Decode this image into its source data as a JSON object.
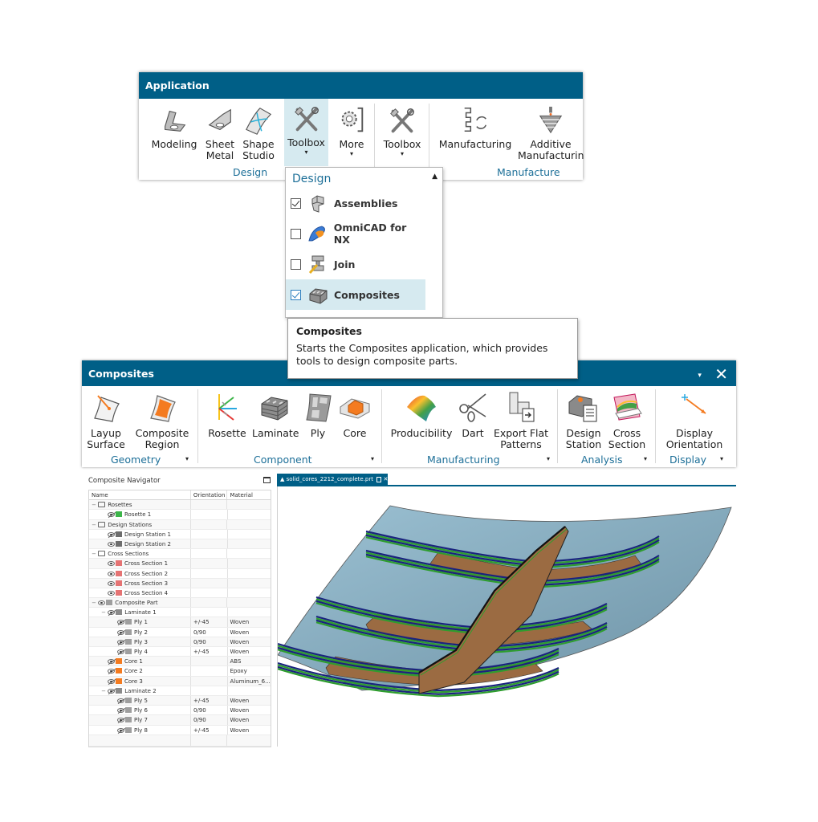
{
  "application_ribbon": {
    "title": "Application",
    "buttons": [
      {
        "label": "Modeling",
        "icon": "modeling-icon"
      },
      {
        "label": "Sheet Metal",
        "icon": "sheet-metal-icon"
      },
      {
        "label": "Shape Studio",
        "icon": "shape-studio-icon"
      },
      {
        "label": "Toolbox",
        "icon": "toolbox-icon",
        "dropdown": true,
        "highlighted": true
      },
      {
        "label": "More",
        "icon": "more-gear-icon",
        "dropdown": true
      },
      {
        "label": "Toolbox",
        "icon": "toolbox-icon",
        "dropdown": true
      },
      {
        "label": "Manufacturing",
        "icon": "manufacturing-icon"
      },
      {
        "label": "Additive Manufacturing",
        "icon": "additive-manufacturing-icon"
      }
    ],
    "groups": [
      "Design",
      "Manufacture"
    ],
    "labels": {
      "modeling": "Modeling",
      "sheet_metal_1": "Sheet",
      "sheet_metal_2": "Metal",
      "shape_studio_1": "Shape",
      "shape_studio_2": "Studio",
      "toolbox": "Toolbox",
      "more": "More",
      "manufacturing": "Manufacturing",
      "additive_1": "Additive",
      "additive_2": "Manufacturin",
      "caret": "▾"
    }
  },
  "toolbox_dropdown": {
    "header": "Design",
    "collapse_glyph": "▲",
    "items": [
      {
        "label": "Assemblies",
        "checked": true
      },
      {
        "label": "OmniCAD for NX",
        "checked": false
      },
      {
        "label": "Join",
        "checked": false
      },
      {
        "label": "Composites",
        "checked": true,
        "hovered": true
      }
    ]
  },
  "tooltip": {
    "title": "Composites",
    "body": "Starts the Composites application, which provides tools to design composite parts."
  },
  "composites_ribbon": {
    "title": "Composites",
    "minimize_glyph": "▾",
    "close_glyph": "✕",
    "buttons": {
      "layup_1": "Layup",
      "layup_2": "Surface",
      "region_1": "Composite",
      "region_2": "Region",
      "rosette": "Rosette",
      "laminate": "Laminate",
      "ply": "Ply",
      "core": "Core",
      "producibility": "Producibility",
      "dart": "Dart",
      "export_1": "Export Flat",
      "export_2": "Patterns",
      "design_station_1": "Design",
      "design_station_2": "Station",
      "cross_section_1": "Cross",
      "cross_section_2": "Section",
      "display_1": "Display",
      "display_2": "Orientation"
    },
    "groups": {
      "geometry": "Geometry",
      "component": "Component",
      "manufacturing": "Manufacturing",
      "analysis": "Analysis",
      "display": "Display"
    },
    "group_caret": "▾"
  },
  "navigator": {
    "title": "Composite Navigator",
    "columns": [
      "Name",
      "Orientation",
      "Material"
    ],
    "rows": [
      {
        "name": "Rosettes",
        "level": 0,
        "type": "folder",
        "expand": "−",
        "orientation": "",
        "material": ""
      },
      {
        "name": "Rosette 1",
        "level": 1,
        "type": "rosette",
        "eye": "off",
        "orientation": "",
        "material": ""
      },
      {
        "name": "Design Stations",
        "level": 0,
        "type": "folder",
        "expand": "−",
        "orientation": "",
        "material": ""
      },
      {
        "name": "Design Station 1",
        "level": 1,
        "type": "station",
        "eye": "off",
        "orientation": "",
        "material": ""
      },
      {
        "name": "Design Station 2",
        "level": 1,
        "type": "station",
        "eye": "on",
        "orientation": "",
        "material": ""
      },
      {
        "name": "Cross Sections",
        "level": 0,
        "type": "folder",
        "expand": "−",
        "orientation": "",
        "material": ""
      },
      {
        "name": "Cross Section 1",
        "level": 1,
        "type": "section",
        "eye": "on",
        "orientation": "",
        "material": ""
      },
      {
        "name": "Cross Section 2",
        "level": 1,
        "type": "section",
        "eye": "on",
        "orientation": "",
        "material": ""
      },
      {
        "name": "Cross Section 3",
        "level": 1,
        "type": "section",
        "eye": "on",
        "orientation": "",
        "material": ""
      },
      {
        "name": "Cross Section 4",
        "level": 1,
        "type": "section",
        "eye": "on",
        "orientation": "",
        "material": ""
      },
      {
        "name": "Composite Part",
        "level": 0,
        "type": "part",
        "expand": "−",
        "eye": "on",
        "orientation": "",
        "material": ""
      },
      {
        "name": "Laminate 1",
        "level": 1,
        "type": "laminate",
        "expand": "−",
        "eye": "off",
        "orientation": "",
        "material": ""
      },
      {
        "name": "Ply 1",
        "level": 2,
        "type": "ply",
        "eye": "off",
        "orientation": "+/-45",
        "material": "Woven"
      },
      {
        "name": "Ply 2",
        "level": 2,
        "type": "ply",
        "eye": "off",
        "orientation": "0/90",
        "material": "Woven"
      },
      {
        "name": "Ply 3",
        "level": 2,
        "type": "ply",
        "eye": "off",
        "orientation": "0/90",
        "material": "Woven"
      },
      {
        "name": "Ply 4",
        "level": 2,
        "type": "ply",
        "eye": "off",
        "orientation": "+/-45",
        "material": "Woven"
      },
      {
        "name": "Core 1",
        "level": 1,
        "type": "core",
        "eye": "off",
        "orientation": "",
        "material": "ABS"
      },
      {
        "name": "Core 2",
        "level": 1,
        "type": "core",
        "eye": "off",
        "orientation": "",
        "material": "Epoxy"
      },
      {
        "name": "Core 3",
        "level": 1,
        "type": "core",
        "eye": "off",
        "orientation": "",
        "material": "Aluminum_6..."
      },
      {
        "name": "Laminate 2",
        "level": 1,
        "type": "laminate",
        "expand": "−",
        "eye": "off",
        "orientation": "",
        "material": ""
      },
      {
        "name": "Ply 5",
        "level": 2,
        "type": "ply",
        "eye": "off",
        "orientation": "+/-45",
        "material": "Woven"
      },
      {
        "name": "Ply 6",
        "level": 2,
        "type": "ply",
        "eye": "off",
        "orientation": "0/90",
        "material": "Woven"
      },
      {
        "name": "Ply 7",
        "level": 2,
        "type": "ply",
        "eye": "off",
        "orientation": "0/90",
        "material": "Woven"
      },
      {
        "name": "Ply 8",
        "level": 2,
        "type": "ply",
        "eye": "off",
        "orientation": "+/-45",
        "material": "Woven"
      }
    ]
  },
  "graphics_window": {
    "tab_label": "solid_cores_2212_complete.prt",
    "tab_close": "✕"
  },
  "colors": {
    "title_bar": "#005f87",
    "group_label": "#1d6f98",
    "highlight": "#d6eaf0",
    "skin": "#8fb3c6",
    "core": "#9b6b42",
    "ply_blue": "#1a237e",
    "ply_green": "#2e9d2e"
  }
}
